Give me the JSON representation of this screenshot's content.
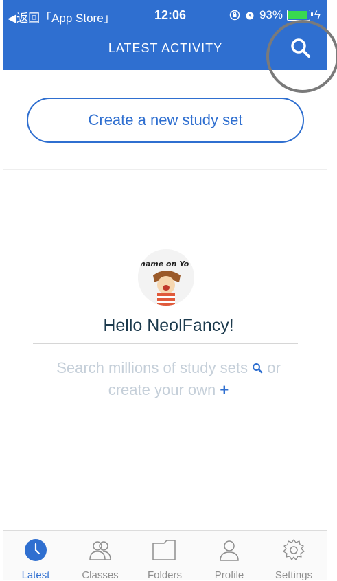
{
  "status_bar": {
    "back_label": "◀返回「App Store」",
    "time": "12:06",
    "battery": "93%",
    "battery_level": 0.93
  },
  "header": {
    "title": "LATEST ACTIVITY",
    "search_icon": "search-icon"
  },
  "main": {
    "create_button_label": "Create a new study set",
    "greeting": "Hello NeolFancy!",
    "hint_line1": "Search millions of study sets",
    "hint_or": "or",
    "hint_line2": "create your own",
    "plus": "+",
    "avatar_text": "hame on Yo"
  },
  "tabs": [
    {
      "label": "Latest",
      "icon": "clock-icon",
      "active": true
    },
    {
      "label": "Classes",
      "icon": "classes-icon",
      "active": false
    },
    {
      "label": "Folders",
      "icon": "folder-icon",
      "active": false
    },
    {
      "label": "Profile",
      "icon": "profile-icon",
      "active": false
    },
    {
      "label": "Settings",
      "icon": "gear-icon",
      "active": false
    }
  ],
  "colors": {
    "accent": "#2f6fd0",
    "battery": "#39d94f"
  }
}
